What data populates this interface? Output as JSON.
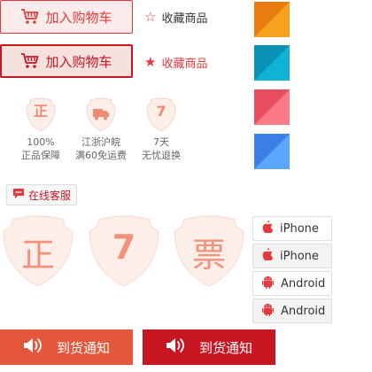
{
  "cart": {
    "label_normal": "加入购物车",
    "label_hover": "加入购物车"
  },
  "favorite": {
    "label_normal": "收藏商品",
    "label_active": "收藏商品",
    "star_empty": "☆",
    "star_filled": "★"
  },
  "color_tiles": [
    "#f08a0e",
    "#0b9ac4",
    "#f0566a",
    "#4a8fef"
  ],
  "services": [
    {
      "glyph": "正",
      "line1": "100%",
      "line2": "正品保障",
      "icon": "shield-genuine-icon"
    },
    {
      "glyph": "",
      "line1": "江浙沪皖",
      "line2": "满60免运费",
      "icon": "shield-truck-icon"
    },
    {
      "glyph": "7",
      "line1": "7天",
      "line2": "无忧退换",
      "icon": "shield-seven-icon"
    }
  ],
  "online_service": {
    "label": "在线客服",
    "icon": "chat-bubble-icon"
  },
  "big_badges": [
    {
      "glyph": "正",
      "icon": "shield-genuine-icon"
    },
    {
      "glyph": "7",
      "icon": "shield-seven-icon"
    },
    {
      "glyph": "票",
      "icon": "shield-invoice-icon"
    }
  ],
  "platforms": [
    {
      "label": "iPhone",
      "icon": "apple-icon",
      "state": "normal"
    },
    {
      "label": "iPhone",
      "icon": "apple-icon",
      "state": "hover"
    },
    {
      "label": "Android",
      "icon": "android-icon",
      "state": "normal"
    },
    {
      "label": "Android",
      "icon": "android-icon",
      "state": "hover"
    }
  ],
  "notify": {
    "label_normal": "到货通知",
    "label_hover": "到货通知",
    "icon": "speaker-icon"
  },
  "colors": {
    "brand_red": "#e4393c",
    "dark_red": "#c81623",
    "notify_orange": "#e4573c",
    "badge_tint": "#fce9e4"
  }
}
